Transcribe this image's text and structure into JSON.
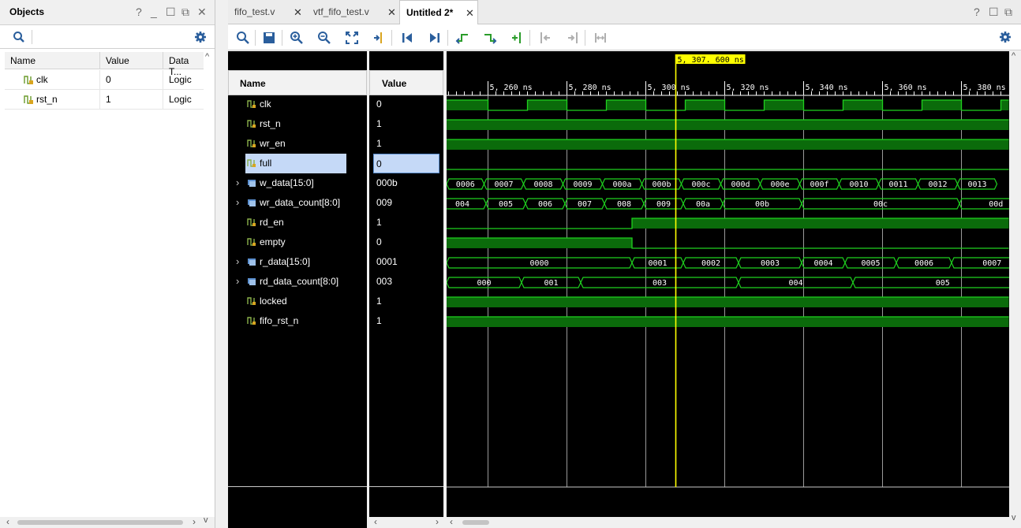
{
  "objects": {
    "title": "Objects",
    "columns": [
      "Name",
      "Value",
      "Data T..."
    ],
    "rows": [
      {
        "name": "clk",
        "value": "0",
        "type": "Logic"
      },
      {
        "name": "rst_n",
        "value": "1",
        "type": "Logic"
      }
    ]
  },
  "tabs": [
    {
      "label": "fifo_test.v",
      "active": false
    },
    {
      "label": "vtf_fifo_test.v",
      "active": false
    },
    {
      "label": "Untitled 2*",
      "active": true
    }
  ],
  "wave": {
    "name_header": "Name",
    "value_header": "Value",
    "cursor_label": "5, 307. 600  ns",
    "time_labels": [
      "5, 260  ns",
      "5, 280  ns",
      "5, 300  ns",
      "5, 320  ns",
      "5, 340  ns",
      "5, 360  ns",
      "5, 380  ns"
    ],
    "signals": [
      {
        "name": "clk",
        "value": "0",
        "kind": "bit",
        "expandable": false
      },
      {
        "name": "rst_n",
        "value": "1",
        "kind": "bit",
        "expandable": false
      },
      {
        "name": "wr_en",
        "value": "1",
        "kind": "bit",
        "expandable": false
      },
      {
        "name": "full",
        "value": "0",
        "kind": "bit",
        "expandable": false,
        "selected": true
      },
      {
        "name": "w_data[15:0]",
        "value": "000b",
        "kind": "bus",
        "expandable": true
      },
      {
        "name": "wr_data_count[8:0]",
        "value": "009",
        "kind": "bus",
        "expandable": true
      },
      {
        "name": "rd_en",
        "value": "1",
        "kind": "bit",
        "expandable": false
      },
      {
        "name": "empty",
        "value": "0",
        "kind": "bit",
        "expandable": false
      },
      {
        "name": "r_data[15:0]",
        "value": "0001",
        "kind": "bus",
        "expandable": true
      },
      {
        "name": "rd_data_count[8:0]",
        "value": "003",
        "kind": "bus",
        "expandable": true
      },
      {
        "name": "locked",
        "value": "1",
        "kind": "bit",
        "expandable": false
      },
      {
        "name": "fifo_rst_n",
        "value": "1",
        "kind": "bit",
        "expandable": false
      }
    ],
    "bus_segments": {
      "w_data": [
        "0006",
        "0007",
        "0008",
        "0009",
        "000a",
        "000b",
        "000c",
        "000d",
        "000e",
        "000f",
        "0010",
        "0011",
        "0012",
        "0013"
      ],
      "wr_data_count": [
        "004",
        "005",
        "006",
        "007",
        "008",
        "009",
        "00a",
        "00b",
        "00c",
        "00d"
      ],
      "r_data": [
        "0000",
        "0001",
        "0002",
        "0003",
        "0004",
        "0005",
        "0006",
        "0007"
      ],
      "rd_data_count": [
        "000",
        "001",
        "003",
        "004",
        "005"
      ]
    },
    "colors": {
      "wave": "#1fd11f",
      "fill": "#0b6b0b",
      "cursor": "#ffff00",
      "selection": "#c5d9f7"
    }
  }
}
